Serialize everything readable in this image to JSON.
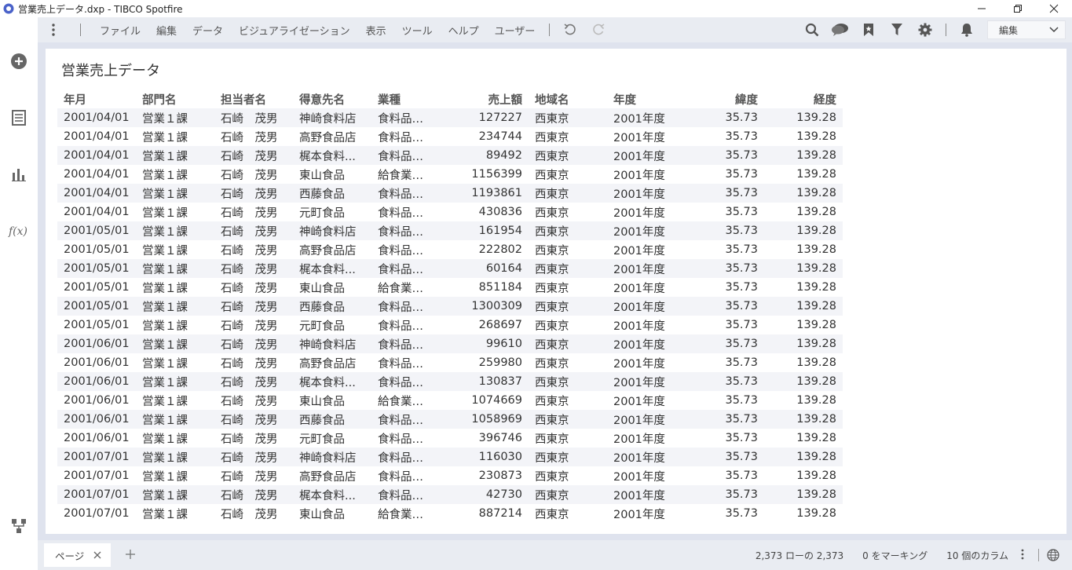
{
  "window": {
    "title": "営業売上データ.dxp - TIBCO Spotfire"
  },
  "menu": {
    "items": [
      "ファイル",
      "編集",
      "データ",
      "ビジュアライゼーション",
      "表示",
      "ツール",
      "ヘルプ",
      "ユーザー"
    ],
    "mode_select": "編集"
  },
  "visualization": {
    "title": "営業売上データ",
    "columns": [
      "年月",
      "部門名",
      "担当者名",
      "得意先名",
      "業種",
      "売上額",
      "地域名",
      "年度",
      "緯度",
      "経度"
    ],
    "rows": [
      [
        "2001/04/01",
        "営業１課",
        "石崎　茂男",
        "神崎食料店",
        "食料品店...",
        "127227",
        "西東京",
        "2001年度",
        "35.73",
        "139.28"
      ],
      [
        "2001/04/01",
        "営業１課",
        "石崎　茂男",
        "高野食品店",
        "食料品店...",
        "234744",
        "西東京",
        "2001年度",
        "35.73",
        "139.28"
      ],
      [
        "2001/04/01",
        "営業１課",
        "石崎　茂男",
        "梶本食料...",
        "食料品店...",
        "89492",
        "西東京",
        "2001年度",
        "35.73",
        "139.28"
      ],
      [
        "2001/04/01",
        "営業１課",
        "石崎　茂男",
        "東山食品",
        "給食業　...",
        "1156399",
        "西東京",
        "2001年度",
        "35.73",
        "139.28"
      ],
      [
        "2001/04/01",
        "営業１課",
        "石崎　茂男",
        "西藤食品",
        "食料品店...",
        "1193861",
        "西東京",
        "2001年度",
        "35.73",
        "139.28"
      ],
      [
        "2001/04/01",
        "営業１課",
        "石崎　茂男",
        "元町食品",
        "食料品卸...",
        "430836",
        "西東京",
        "2001年度",
        "35.73",
        "139.28"
      ],
      [
        "2001/05/01",
        "営業１課",
        "石崎　茂男",
        "神崎食料店",
        "食料品店...",
        "161954",
        "西東京",
        "2001年度",
        "35.73",
        "139.28"
      ],
      [
        "2001/05/01",
        "営業１課",
        "石崎　茂男",
        "高野食品店",
        "食料品店...",
        "222802",
        "西東京",
        "2001年度",
        "35.73",
        "139.28"
      ],
      [
        "2001/05/01",
        "営業１課",
        "石崎　茂男",
        "梶本食料...",
        "食料品店...",
        "60164",
        "西東京",
        "2001年度",
        "35.73",
        "139.28"
      ],
      [
        "2001/05/01",
        "営業１課",
        "石崎　茂男",
        "東山食品",
        "給食業　...",
        "851184",
        "西東京",
        "2001年度",
        "35.73",
        "139.28"
      ],
      [
        "2001/05/01",
        "営業１課",
        "石崎　茂男",
        "西藤食品",
        "食料品店...",
        "1300309",
        "西東京",
        "2001年度",
        "35.73",
        "139.28"
      ],
      [
        "2001/05/01",
        "営業１課",
        "石崎　茂男",
        "元町食品",
        "食料品卸...",
        "268697",
        "西東京",
        "2001年度",
        "35.73",
        "139.28"
      ],
      [
        "2001/06/01",
        "営業１課",
        "石崎　茂男",
        "神崎食料店",
        "食料品店...",
        "99610",
        "西東京",
        "2001年度",
        "35.73",
        "139.28"
      ],
      [
        "2001/06/01",
        "営業１課",
        "石崎　茂男",
        "高野食品店",
        "食料品店...",
        "259980",
        "西東京",
        "2001年度",
        "35.73",
        "139.28"
      ],
      [
        "2001/06/01",
        "営業１課",
        "石崎　茂男",
        "梶本食料...",
        "食料品店...",
        "130837",
        "西東京",
        "2001年度",
        "35.73",
        "139.28"
      ],
      [
        "2001/06/01",
        "営業１課",
        "石崎　茂男",
        "東山食品",
        "給食業　...",
        "1074669",
        "西東京",
        "2001年度",
        "35.73",
        "139.28"
      ],
      [
        "2001/06/01",
        "営業１課",
        "石崎　茂男",
        "西藤食品",
        "食料品店...",
        "1058969",
        "西東京",
        "2001年度",
        "35.73",
        "139.28"
      ],
      [
        "2001/06/01",
        "営業１課",
        "石崎　茂男",
        "元町食品",
        "食料品卸...",
        "396746",
        "西東京",
        "2001年度",
        "35.73",
        "139.28"
      ],
      [
        "2001/07/01",
        "営業１課",
        "石崎　茂男",
        "神崎食料店",
        "食料品店...",
        "116030",
        "西東京",
        "2001年度",
        "35.73",
        "139.28"
      ],
      [
        "2001/07/01",
        "営業１課",
        "石崎　茂男",
        "高野食品店",
        "食料品店...",
        "230873",
        "西東京",
        "2001年度",
        "35.73",
        "139.28"
      ],
      [
        "2001/07/01",
        "営業１課",
        "石崎　茂男",
        "梶本食料...",
        "食料品店...",
        "42730",
        "西東京",
        "2001年度",
        "35.73",
        "139.28"
      ],
      [
        "2001/07/01",
        "営業１課",
        "石崎　茂男",
        "東山食品",
        "給食業　...",
        "887214",
        "西東京",
        "2001年度",
        "35.73",
        "139.28"
      ]
    ]
  },
  "statusbar": {
    "page_tab": "ページ",
    "row_count": "2,373 ローの 2,373",
    "marked": "0 をマーキング",
    "columns": "10 個のカラム"
  },
  "colors": {
    "accent": "#4a62c9",
    "menubar": "#e9ecf2",
    "canvas": "#dfe3ee"
  },
  "icons": [
    "spotfire-logo-icon",
    "minimize-icon",
    "restore-icon",
    "close-icon",
    "add-icon",
    "data-table-icon",
    "chart-icon",
    "function-icon",
    "hierarchy-icon",
    "more-vertical-icon",
    "undo-icon",
    "redo-icon",
    "search-icon",
    "comments-icon",
    "bookmark-icon",
    "filter-icon",
    "gear-icon",
    "bell-icon",
    "chevron-down-icon",
    "globe-icon"
  ]
}
